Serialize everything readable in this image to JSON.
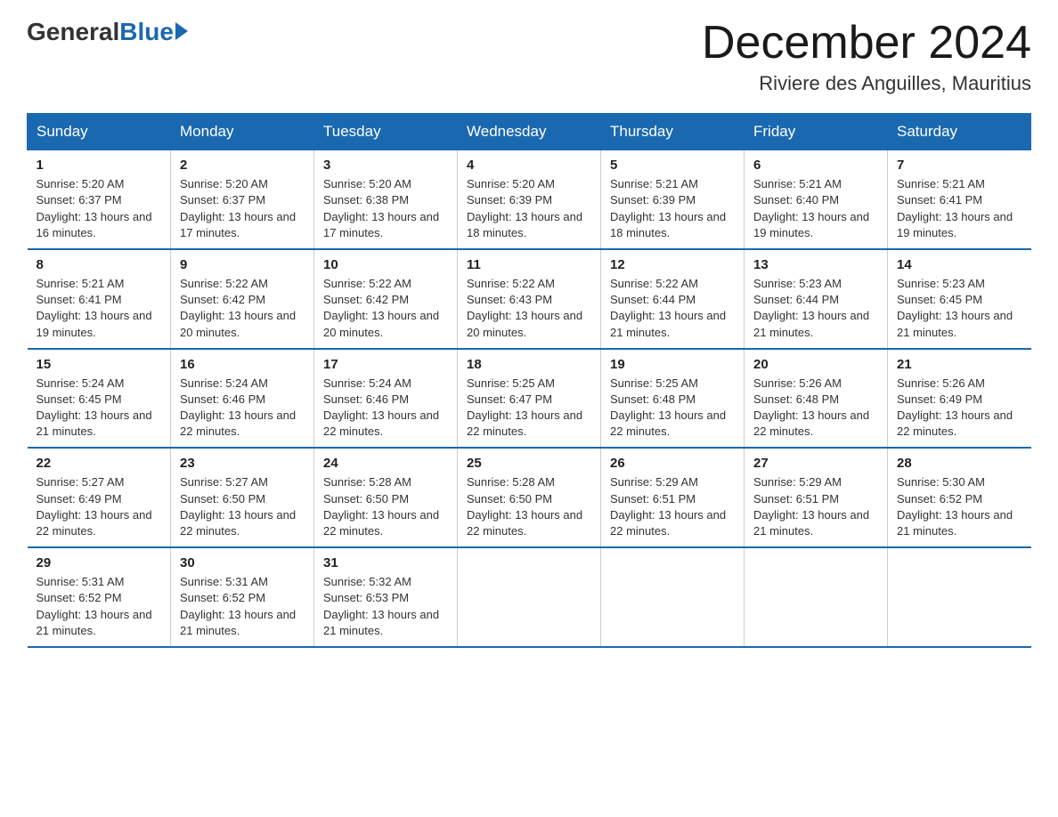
{
  "logo": {
    "general": "General",
    "blue": "Blue"
  },
  "title": "December 2024",
  "location": "Riviere des Anguilles, Mauritius",
  "days_of_week": [
    "Sunday",
    "Monday",
    "Tuesday",
    "Wednesday",
    "Thursday",
    "Friday",
    "Saturday"
  ],
  "weeks": [
    [
      {
        "day": "1",
        "sunrise": "5:20 AM",
        "sunset": "6:37 PM",
        "daylight": "13 hours and 16 minutes."
      },
      {
        "day": "2",
        "sunrise": "5:20 AM",
        "sunset": "6:37 PM",
        "daylight": "13 hours and 17 minutes."
      },
      {
        "day": "3",
        "sunrise": "5:20 AM",
        "sunset": "6:38 PM",
        "daylight": "13 hours and 17 minutes."
      },
      {
        "day": "4",
        "sunrise": "5:20 AM",
        "sunset": "6:39 PM",
        "daylight": "13 hours and 18 minutes."
      },
      {
        "day": "5",
        "sunrise": "5:21 AM",
        "sunset": "6:39 PM",
        "daylight": "13 hours and 18 minutes."
      },
      {
        "day": "6",
        "sunrise": "5:21 AM",
        "sunset": "6:40 PM",
        "daylight": "13 hours and 19 minutes."
      },
      {
        "day": "7",
        "sunrise": "5:21 AM",
        "sunset": "6:41 PM",
        "daylight": "13 hours and 19 minutes."
      }
    ],
    [
      {
        "day": "8",
        "sunrise": "5:21 AM",
        "sunset": "6:41 PM",
        "daylight": "13 hours and 19 minutes."
      },
      {
        "day": "9",
        "sunrise": "5:22 AM",
        "sunset": "6:42 PM",
        "daylight": "13 hours and 20 minutes."
      },
      {
        "day": "10",
        "sunrise": "5:22 AM",
        "sunset": "6:42 PM",
        "daylight": "13 hours and 20 minutes."
      },
      {
        "day": "11",
        "sunrise": "5:22 AM",
        "sunset": "6:43 PM",
        "daylight": "13 hours and 20 minutes."
      },
      {
        "day": "12",
        "sunrise": "5:22 AM",
        "sunset": "6:44 PM",
        "daylight": "13 hours and 21 minutes."
      },
      {
        "day": "13",
        "sunrise": "5:23 AM",
        "sunset": "6:44 PM",
        "daylight": "13 hours and 21 minutes."
      },
      {
        "day": "14",
        "sunrise": "5:23 AM",
        "sunset": "6:45 PM",
        "daylight": "13 hours and 21 minutes."
      }
    ],
    [
      {
        "day": "15",
        "sunrise": "5:24 AM",
        "sunset": "6:45 PM",
        "daylight": "13 hours and 21 minutes."
      },
      {
        "day": "16",
        "sunrise": "5:24 AM",
        "sunset": "6:46 PM",
        "daylight": "13 hours and 22 minutes."
      },
      {
        "day": "17",
        "sunrise": "5:24 AM",
        "sunset": "6:46 PM",
        "daylight": "13 hours and 22 minutes."
      },
      {
        "day": "18",
        "sunrise": "5:25 AM",
        "sunset": "6:47 PM",
        "daylight": "13 hours and 22 minutes."
      },
      {
        "day": "19",
        "sunrise": "5:25 AM",
        "sunset": "6:48 PM",
        "daylight": "13 hours and 22 minutes."
      },
      {
        "day": "20",
        "sunrise": "5:26 AM",
        "sunset": "6:48 PM",
        "daylight": "13 hours and 22 minutes."
      },
      {
        "day": "21",
        "sunrise": "5:26 AM",
        "sunset": "6:49 PM",
        "daylight": "13 hours and 22 minutes."
      }
    ],
    [
      {
        "day": "22",
        "sunrise": "5:27 AM",
        "sunset": "6:49 PM",
        "daylight": "13 hours and 22 minutes."
      },
      {
        "day": "23",
        "sunrise": "5:27 AM",
        "sunset": "6:50 PM",
        "daylight": "13 hours and 22 minutes."
      },
      {
        "day": "24",
        "sunrise": "5:28 AM",
        "sunset": "6:50 PM",
        "daylight": "13 hours and 22 minutes."
      },
      {
        "day": "25",
        "sunrise": "5:28 AM",
        "sunset": "6:50 PM",
        "daylight": "13 hours and 22 minutes."
      },
      {
        "day": "26",
        "sunrise": "5:29 AM",
        "sunset": "6:51 PM",
        "daylight": "13 hours and 22 minutes."
      },
      {
        "day": "27",
        "sunrise": "5:29 AM",
        "sunset": "6:51 PM",
        "daylight": "13 hours and 21 minutes."
      },
      {
        "day": "28",
        "sunrise": "5:30 AM",
        "sunset": "6:52 PM",
        "daylight": "13 hours and 21 minutes."
      }
    ],
    [
      {
        "day": "29",
        "sunrise": "5:31 AM",
        "sunset": "6:52 PM",
        "daylight": "13 hours and 21 minutes."
      },
      {
        "day": "30",
        "sunrise": "5:31 AM",
        "sunset": "6:52 PM",
        "daylight": "13 hours and 21 minutes."
      },
      {
        "day": "31",
        "sunrise": "5:32 AM",
        "sunset": "6:53 PM",
        "daylight": "13 hours and 21 minutes."
      },
      null,
      null,
      null,
      null
    ]
  ]
}
